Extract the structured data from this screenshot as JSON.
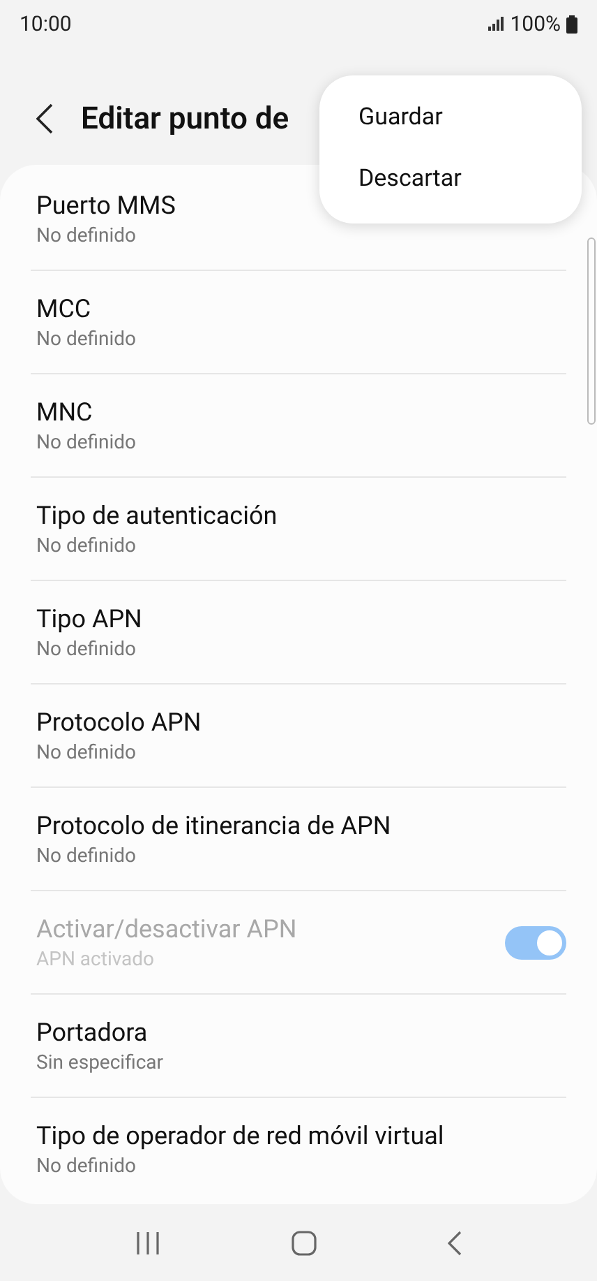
{
  "status_bar": {
    "time": "10:00",
    "battery": "100%"
  },
  "header": {
    "title": "Editar punto de"
  },
  "menu": {
    "items": [
      "Guardar",
      "Descartar"
    ]
  },
  "settings": [
    {
      "kind": "text",
      "title": "Puerto MMS",
      "value": "No definido",
      "disabled": false
    },
    {
      "kind": "text",
      "title": "MCC",
      "value": "No definido",
      "disabled": false
    },
    {
      "kind": "text",
      "title": "MNC",
      "value": "No definido",
      "disabled": false
    },
    {
      "kind": "text",
      "title": "Tipo de autenticación",
      "value": "No definido",
      "disabled": false
    },
    {
      "kind": "text",
      "title": "Tipo APN",
      "value": "No definido",
      "disabled": false
    },
    {
      "kind": "text",
      "title": "Protocolo APN",
      "value": "No definido",
      "disabled": false
    },
    {
      "kind": "text",
      "title": "Protocolo de itinerancia de APN",
      "value": "No definido",
      "disabled": false
    },
    {
      "kind": "toggle",
      "title": "Activar/desactivar APN",
      "value": "APN activado",
      "disabled": true,
      "on": true
    },
    {
      "kind": "text",
      "title": "Portadora",
      "value": "Sin especificar",
      "disabled": false
    },
    {
      "kind": "text",
      "title": "Tipo de operador de red móvil virtual",
      "value": "No definido",
      "disabled": false
    }
  ]
}
